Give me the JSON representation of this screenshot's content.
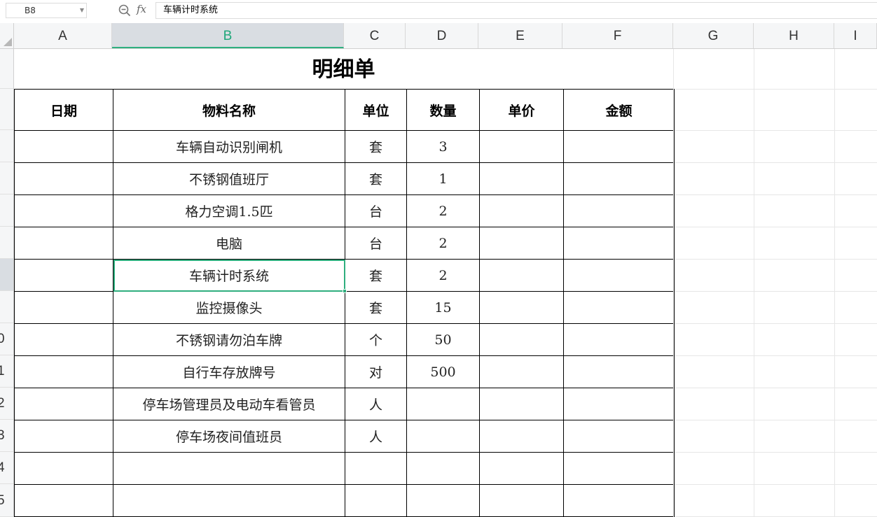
{
  "formula_bar": {
    "cell_ref": "B8",
    "fx_label": "fx",
    "formula": "车辆计时系统"
  },
  "columns": [
    "A",
    "B",
    "C",
    "D",
    "E",
    "F",
    "G",
    "H",
    "I"
  ],
  "selected_column": "B",
  "rows": [
    "",
    "",
    "",
    "",
    "",
    "",
    "",
    "0",
    "1",
    "2",
    "3",
    "4",
    "5"
  ],
  "sheet": {
    "title": "明细单",
    "headers": [
      "日期",
      "物料名称",
      "单位",
      "数量",
      "单价",
      "金额"
    ],
    "rows": [
      [
        "",
        "车辆自动识别闸机",
        "套",
        "3",
        "",
        ""
      ],
      [
        "",
        "不锈钢值班厅",
        "套",
        "1",
        "",
        ""
      ],
      [
        "",
        "格力空调1.5匹",
        "台",
        "2",
        "",
        ""
      ],
      [
        "",
        "电脑",
        "台",
        "2",
        "",
        ""
      ],
      [
        "",
        "车辆计时系统",
        "套",
        "2",
        "",
        ""
      ],
      [
        "",
        "监控摄像头",
        "套",
        "15",
        "",
        ""
      ],
      [
        "",
        "不锈钢请勿泊车牌",
        "个",
        "50",
        "",
        ""
      ],
      [
        "",
        "自行车存放牌号",
        "对",
        "500",
        "",
        ""
      ],
      [
        "",
        "停车场管理员及电动车看管员",
        "人",
        "",
        "",
        ""
      ],
      [
        "",
        "停车场夜间值班员",
        "人",
        "",
        "",
        ""
      ],
      [
        "",
        "",
        "",
        "",
        "",
        ""
      ],
      [
        "",
        "",
        "",
        "",
        "",
        ""
      ]
    ]
  },
  "colors": {
    "accent": "#2fae7e",
    "header_bg": "#f5f6f7",
    "selected_header_bg": "#d9dde2"
  }
}
